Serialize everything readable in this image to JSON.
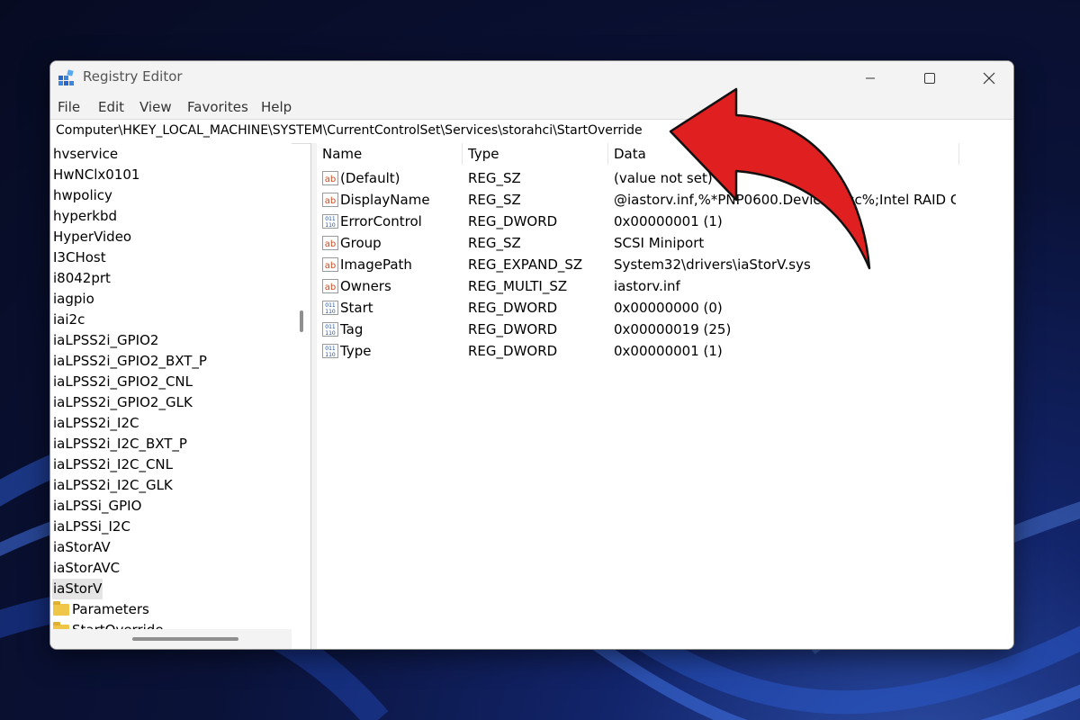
{
  "window": {
    "title": "Registry Editor"
  },
  "menu": [
    "File",
    "Edit",
    "View",
    "Favorites",
    "Help"
  ],
  "address": "Computer\\HKEY_LOCAL_MACHINE\\SYSTEM\\CurrentControlSet\\Services\\storahci\\StartOverride",
  "tree": {
    "items": [
      "hvservice",
      "HwNClx0101",
      "hwpolicy",
      "hyperkbd",
      "HyperVideo",
      "I3CHost",
      "i8042prt",
      "iagpio",
      "iai2c",
      "iaLPSS2i_GPIO2",
      "iaLPSS2i_GPIO2_BXT_P",
      "iaLPSS2i_GPIO2_CNL",
      "iaLPSS2i_GPIO2_GLK",
      "iaLPSS2i_I2C",
      "iaLPSS2i_I2C_BXT_P",
      "iaLPSS2i_I2C_CNL",
      "iaLPSS2i_I2C_GLK",
      "iaLPSSi_GPIO",
      "iaLPSSi_I2C",
      "iaStorAV",
      "iaStorAVC",
      "iaStorV"
    ],
    "selected": "iaStorV",
    "children": [
      "Parameters",
      "StartOverride"
    ]
  },
  "columns": [
    "Name",
    "Type",
    "Data"
  ],
  "rows": [
    {
      "icon": "string-value-icon",
      "name": "(Default)",
      "type": "REG_SZ",
      "data": "(value not set)"
    },
    {
      "icon": "string-value-icon",
      "name": "DisplayName",
      "type": "REG_SZ",
      "data": "@iastorv.inf,%*PNP0600.DeviceDesc%;Intel RAID C..."
    },
    {
      "icon": "binary-value-icon",
      "name": "ErrorControl",
      "type": "REG_DWORD",
      "data": "0x00000001 (1)"
    },
    {
      "icon": "string-value-icon",
      "name": "Group",
      "type": "REG_SZ",
      "data": "SCSI Miniport"
    },
    {
      "icon": "string-value-icon",
      "name": "ImagePath",
      "type": "REG_EXPAND_SZ",
      "data": "System32\\drivers\\iaStorV.sys"
    },
    {
      "icon": "string-value-icon",
      "name": "Owners",
      "type": "REG_MULTI_SZ",
      "data": "iastorv.inf"
    },
    {
      "icon": "binary-value-icon",
      "name": "Start",
      "type": "REG_DWORD",
      "data": "0x00000000 (0)"
    },
    {
      "icon": "binary-value-icon",
      "name": "Tag",
      "type": "REG_DWORD",
      "data": "0x00000019 (25)"
    },
    {
      "icon": "binary-value-icon",
      "name": "Type",
      "type": "REG_DWORD",
      "data": "0x00000001 (1)"
    }
  ],
  "icon_labels": {
    "string": "ab",
    "binary_top": "011",
    "binary_bottom": "110"
  },
  "colors": {
    "arrow": "#e02020",
    "folder": "#f0c648",
    "string_icon": "#d04a1a",
    "binary_icon": "#1a4fa0"
  }
}
